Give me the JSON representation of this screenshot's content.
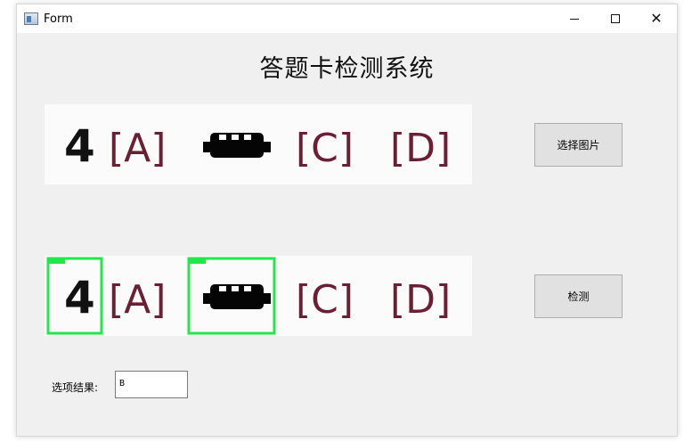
{
  "window": {
    "title": "Form",
    "controls": [
      "minimize-icon",
      "maximize-icon",
      "close-icon"
    ]
  },
  "heading": "答题卡检测系统",
  "original_image": {
    "glyphs": [
      "4",
      "[A]",
      "[C]",
      "[D]"
    ],
    "filled_bubble_glyph": "black-filled-mark"
  },
  "detected_image": {
    "glyphs": [
      "4",
      "[A]",
      "[C]",
      "[D]"
    ],
    "highlight_color": "#22e64a",
    "highlighted": [
      "question-number",
      "filled-option"
    ]
  },
  "buttons": {
    "select_image": "选择图片",
    "detect": "检测"
  },
  "result": {
    "label": "选项结果:",
    "value": "B"
  },
  "colors": {
    "window_bg": "#f0f0f0",
    "button_bg": "#e1e1e1",
    "option_text": "#6b1f35"
  }
}
